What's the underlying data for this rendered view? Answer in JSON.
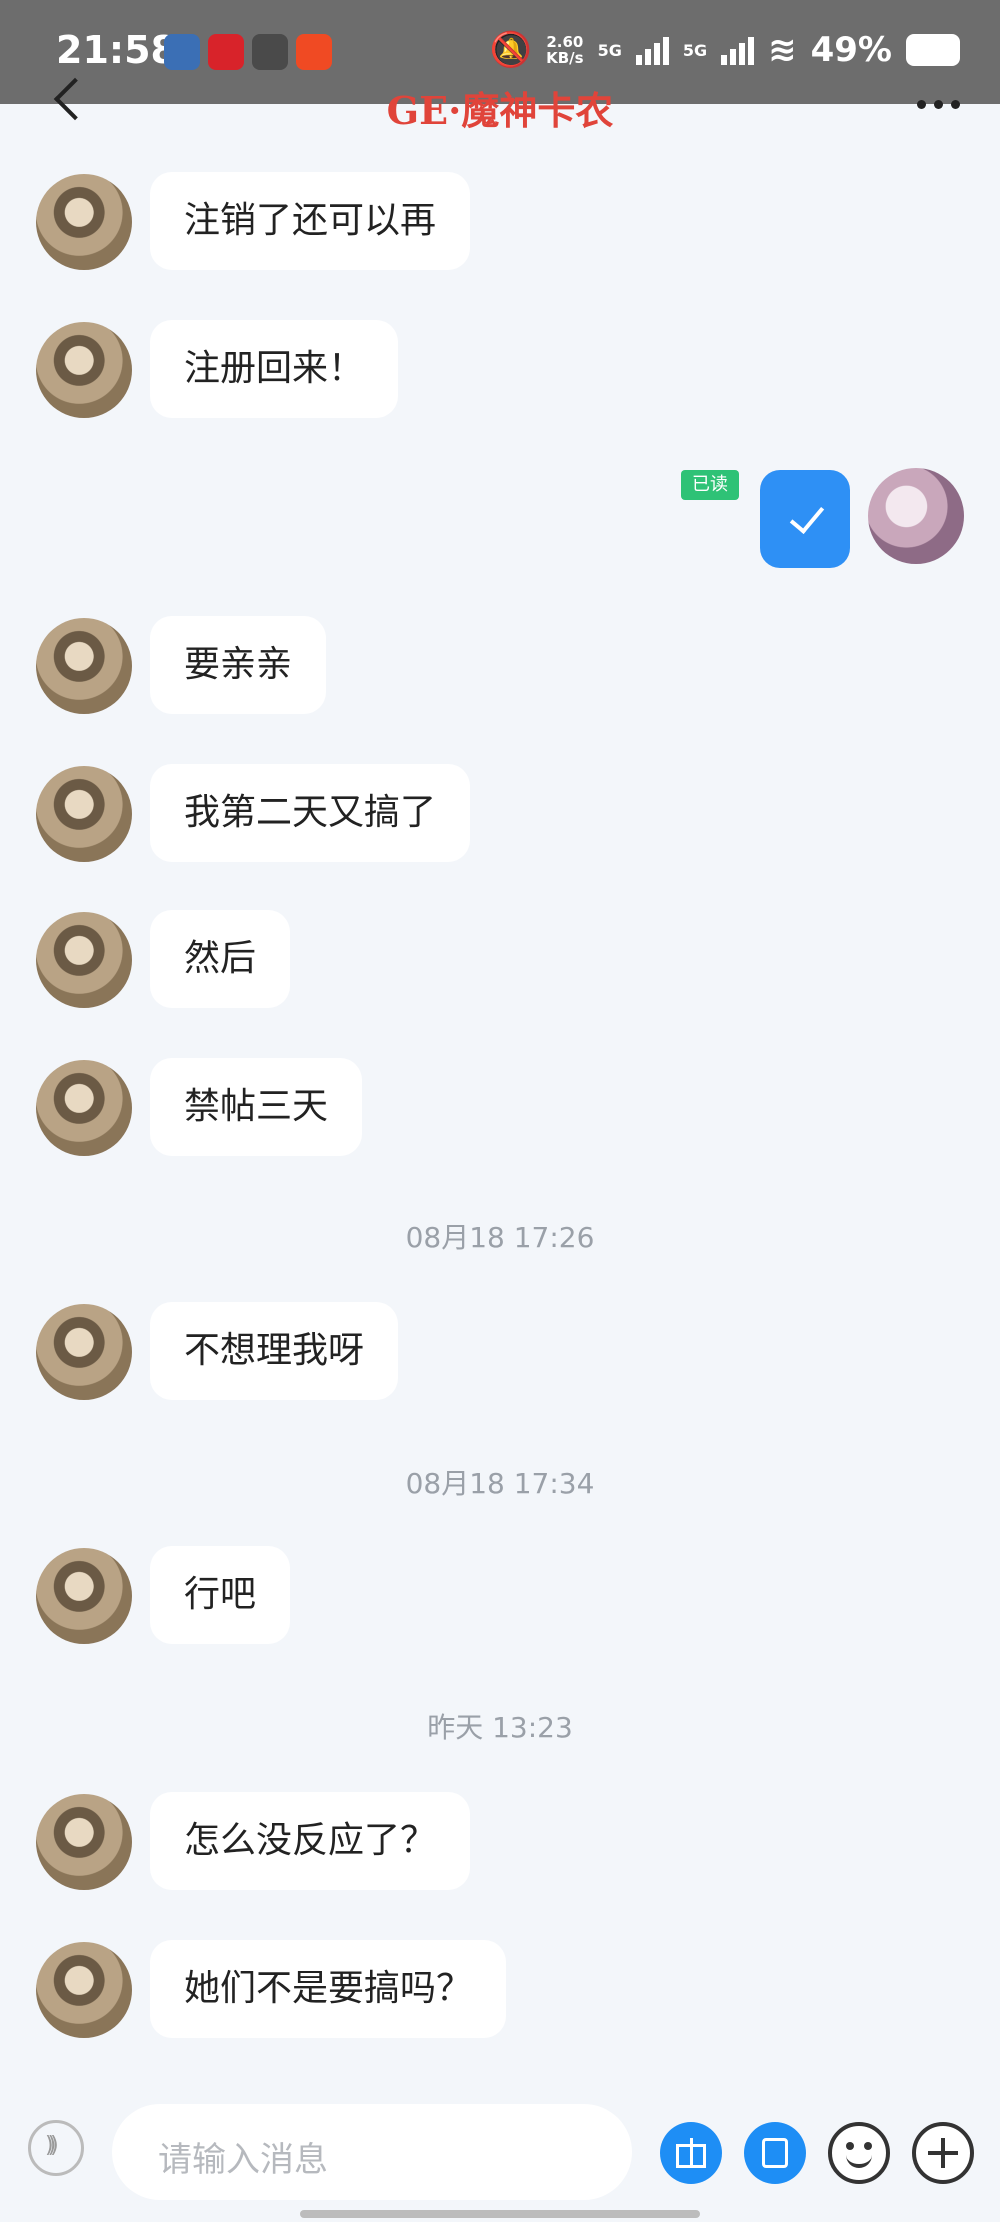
{
  "status": {
    "time": "21:58",
    "net_speed": "2.60",
    "net_unit": "KB/s",
    "net1": "5G",
    "net2": "5G",
    "battery": "49%"
  },
  "header": {
    "title": "GE·魔神卡农"
  },
  "messages": [
    {
      "text": "注销了还可以再"
    },
    {
      "text": "注册回来！"
    },
    {
      "text": "要亲亲"
    },
    {
      "text": "我第二天又搞了"
    },
    {
      "text": "然后"
    },
    {
      "text": "禁帖三天"
    },
    {
      "text": "不想理我呀"
    },
    {
      "text": "行吧"
    },
    {
      "text": "怎么没反应了？"
    },
    {
      "text": "她们不是要搞吗？"
    }
  ],
  "sent": {
    "read_label": "已读"
  },
  "timestamps": [
    "08月18 17:26",
    "08月18 17:34",
    "昨天 13:23"
  ],
  "input": {
    "placeholder": "请输入消息"
  },
  "colors": {
    "accent": "#2e90f5",
    "title": "#e0443a",
    "read_badge": "#2ec276"
  }
}
